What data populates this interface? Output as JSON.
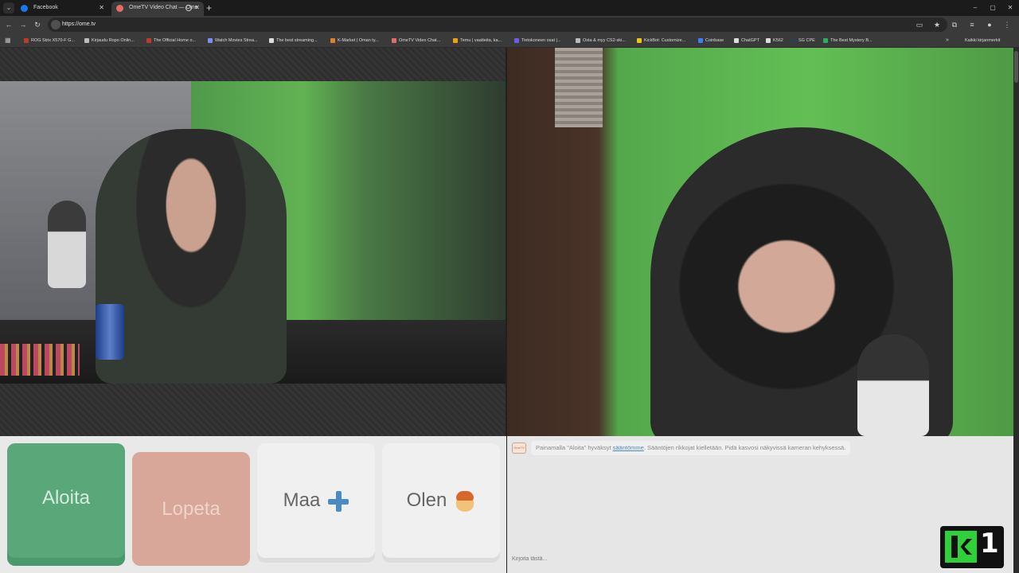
{
  "browser": {
    "tabs": [
      {
        "title": "Facebook",
        "active": false,
        "favicon_color": "#1877f2"
      },
      {
        "title": "OmeTV Video Chat — Ome",
        "active": true,
        "favicon_color": "#e26b6b"
      }
    ],
    "new_tab_symbol": "+",
    "window_controls": [
      "–",
      "▢",
      "✕"
    ],
    "url": "https://ome.tv",
    "bookmarks": [
      {
        "label": "ROG Strix X570-F G...",
        "color": "#c0392b"
      },
      {
        "label": "Kirjaudu Ropo Onlin...",
        "color": "#bbbbbb"
      },
      {
        "label": "The Official Home o...",
        "color": "#c0392b"
      },
      {
        "label": "Watch Movies Strea...",
        "color": "#7e8cff"
      },
      {
        "label": "The best streaming...",
        "color": "#dddddd"
      },
      {
        "label": "K-Market | Oman ty...",
        "color": "#e67e22"
      },
      {
        "label": "OmeTV Video Chat...",
        "color": "#e26b6b"
      },
      {
        "label": "Temu | vaatteita, ka...",
        "color": "#f39c12"
      },
      {
        "label": "Tietokoneen osat |...",
        "color": "#6c5ce7"
      },
      {
        "label": "Osta & myy CS2-ski...",
        "color": "#bbbbbb"
      },
      {
        "label": "KickBot: Customize...",
        "color": "#f1c40f"
      },
      {
        "label": "Coinbase",
        "color": "#3d7bff"
      },
      {
        "label": "ChatGPT",
        "color": "#dddddd"
      },
      {
        "label": "K562",
        "color": "#dddddd"
      },
      {
        "label": "SG CPE",
        "color": "#2c3e50"
      },
      {
        "label": "The Best Mystery B...",
        "color": "#27ae60"
      }
    ],
    "bookmarks_more": "»",
    "all_bookmarks": "Kaikki kirjanmerkit"
  },
  "controls": {
    "start_label": "Aloita",
    "stop_label": "Lopeta",
    "country_label": "Maa",
    "gender_label": "Olen"
  },
  "chat": {
    "logo_text": "OmeTV",
    "msg_prefix": "Painamalla \"Aloita\" hyväksyt ",
    "msg_link": "sääntömme",
    "msg_suffix": ". Sääntöjen rikkojat kielletään. Pidä kasvosi näkyvissä kameran kehyksessä.",
    "input_placeholder": "Kirjoita tästä..."
  },
  "watermark": {
    "letter": "K",
    "number": "1",
    "color": "#2ed13a"
  },
  "icons": [
    "search-icon",
    "back-icon",
    "forward-icon",
    "reload-icon",
    "star-icon",
    "extensions-icon",
    "profile-icon",
    "plus-icon",
    "face-icon"
  ]
}
